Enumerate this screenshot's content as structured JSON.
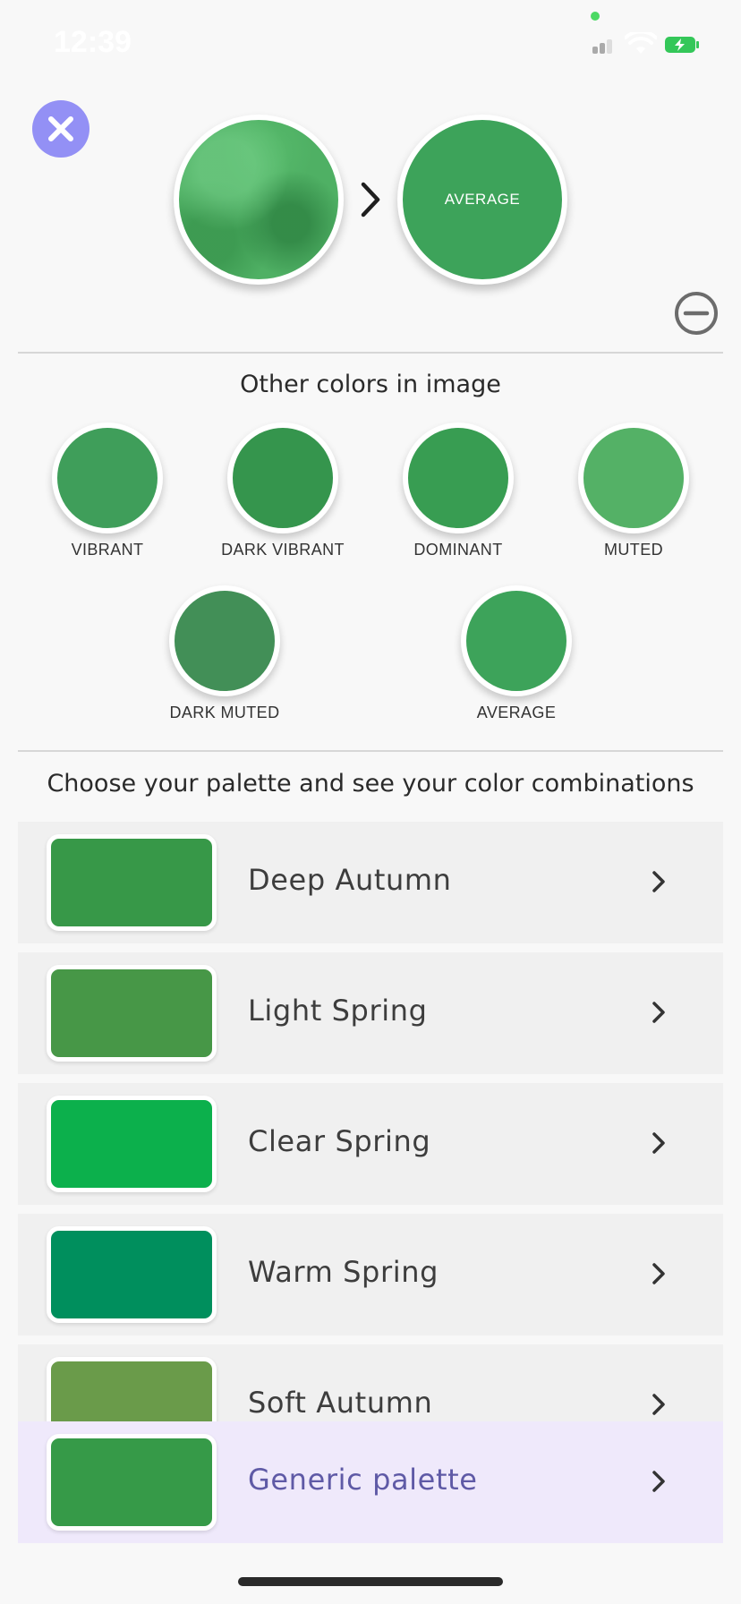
{
  "status_bar": {
    "time": "12:39",
    "signal_icon": "cellular-signal-icon",
    "wifi_icon": "wifi-icon",
    "battery_icon": "battery-charging-icon"
  },
  "header": {
    "close_icon": "close-icon",
    "source_image": "green-texture",
    "result_label": "AVERAGE",
    "result_color": "#3da35a",
    "minus_icon": "minus-circle-icon"
  },
  "other_colors": {
    "title": "Other colors in image",
    "swatches": [
      {
        "label": "VIBRANT",
        "color": "#3f9e5a"
      },
      {
        "label": "DARK VIBRANT",
        "color": "#35954d"
      },
      {
        "label": "DOMINANT",
        "color": "#389d52"
      },
      {
        "label": "MUTED",
        "color": "#54b166"
      },
      {
        "label": "DARK MUTED",
        "color": "#428f57"
      },
      {
        "label": "AVERAGE",
        "color": "#3da35a"
      }
    ]
  },
  "palettes": {
    "title": "Choose your palette and see your color combinations",
    "items": [
      {
        "name": "Deep Autumn",
        "color": "#379848"
      },
      {
        "name": "Light Spring",
        "color": "#479747"
      },
      {
        "name": "Clear Spring",
        "color": "#0cb04c"
      },
      {
        "name": "Warm Spring",
        "color": "#008f5d"
      },
      {
        "name": "Soft Autumn",
        "color": "#6a9b4a"
      },
      {
        "name": "Generic palette",
        "color": "#369a48"
      }
    ]
  }
}
